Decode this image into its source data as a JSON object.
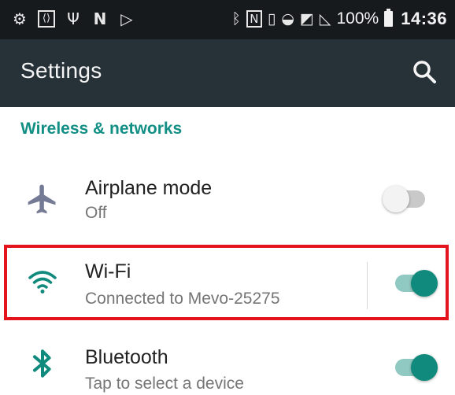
{
  "status_bar": {
    "battery_percent": "100%",
    "time": "14:36",
    "icons_left": [
      "settings-gear-icon",
      "code-box-icon",
      "usb-icon",
      "n-notification-icon",
      "play-store-icon"
    ],
    "icons_right": [
      "bluetooth-icon",
      "nfc-icon",
      "vibrate-icon",
      "wifi-no-internet-icon",
      "no-sim-icon",
      "no-signal-icon",
      "battery-icon"
    ]
  },
  "app_bar": {
    "title": "Settings",
    "search_icon": "search-icon"
  },
  "section": {
    "header": "Wireless & networks"
  },
  "items": [
    {
      "title": "Airplane mode",
      "subtitle": "Off",
      "icon": "airplane-icon",
      "toggle_on": false
    },
    {
      "title": "Wi-Fi",
      "subtitle": "Connected to Mevo-25275",
      "icon": "wifi-icon",
      "toggle_on": true,
      "highlighted": true
    },
    {
      "title": "Bluetooth",
      "subtitle": "Tap to select a device",
      "icon": "bluetooth-icon",
      "toggle_on": true
    }
  ],
  "colors": {
    "status_bar_bg": "#161a1d",
    "app_bar_bg": "#263238",
    "accent": "#0f8a7c",
    "section_header": "#128f84",
    "highlight": "#e3141c"
  }
}
